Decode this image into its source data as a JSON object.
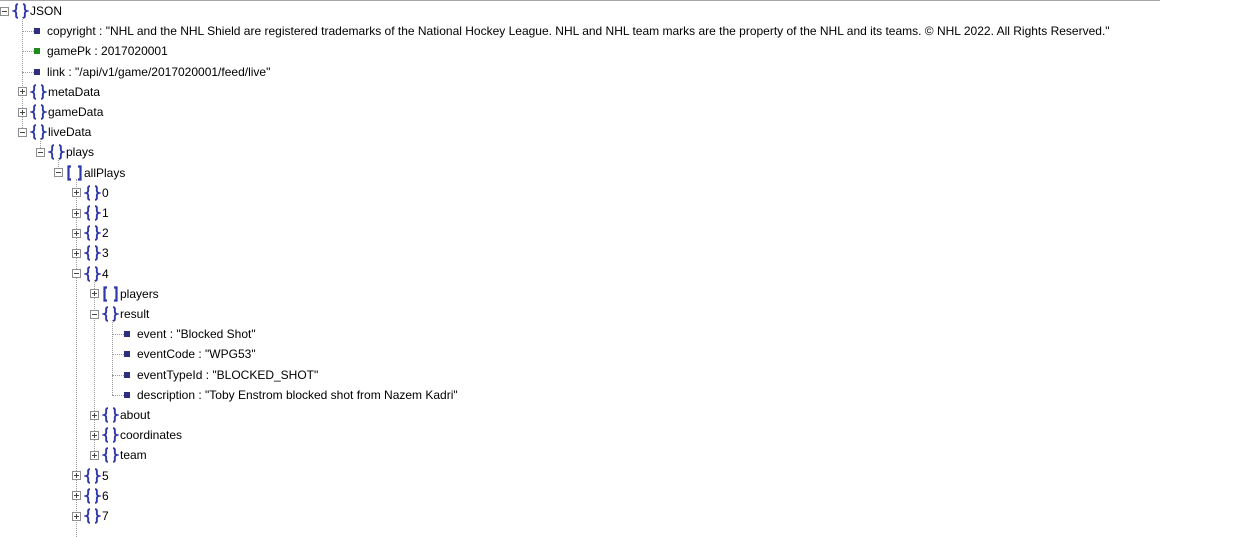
{
  "colors": {
    "object_icon": "#2f37a9",
    "string_bullet": "#2f2f7f",
    "number_bullet": "#1f8c1f",
    "tree_lines": "#9a9a9a"
  },
  "icons": {
    "object": "curly-braces-icon",
    "array": "square-brackets-icon",
    "expand": "plus-box-icon",
    "collapse": "minus-box-icon",
    "value": "square-bullet-icon"
  },
  "rows": [
    {
      "depth": 0,
      "kind": "object",
      "state": "expanded",
      "label": "JSON"
    },
    {
      "depth": 1,
      "kind": "value",
      "vtype": "string",
      "label": "copyright : \"NHL and the NHL Shield are registered trademarks of the National Hockey League. NHL and NHL team marks are the property of the NHL and its teams. © NHL 2022. All Rights Reserved.\""
    },
    {
      "depth": 1,
      "kind": "value",
      "vtype": "number",
      "label": "gamePk : 2017020001"
    },
    {
      "depth": 1,
      "kind": "value",
      "vtype": "string",
      "label": "link : \"/api/v1/game/2017020001/feed/live\""
    },
    {
      "depth": 1,
      "kind": "object",
      "state": "collapsed",
      "label": "metaData"
    },
    {
      "depth": 1,
      "kind": "object",
      "state": "collapsed",
      "label": "gameData"
    },
    {
      "depth": 1,
      "kind": "object",
      "state": "expanded",
      "label": "liveData"
    },
    {
      "depth": 2,
      "kind": "object",
      "state": "expanded",
      "label": "plays"
    },
    {
      "depth": 3,
      "kind": "array",
      "state": "expanded",
      "label": "allPlays"
    },
    {
      "depth": 4,
      "kind": "object",
      "state": "collapsed",
      "label": "0"
    },
    {
      "depth": 4,
      "kind": "object",
      "state": "collapsed",
      "label": "1"
    },
    {
      "depth": 4,
      "kind": "object",
      "state": "collapsed",
      "label": "2"
    },
    {
      "depth": 4,
      "kind": "object",
      "state": "collapsed",
      "label": "3"
    },
    {
      "depth": 4,
      "kind": "object",
      "state": "expanded",
      "label": "4"
    },
    {
      "depth": 5,
      "kind": "array",
      "state": "collapsed",
      "label": "players"
    },
    {
      "depth": 5,
      "kind": "object",
      "state": "expanded",
      "label": "result"
    },
    {
      "depth": 6,
      "kind": "value",
      "vtype": "string",
      "label": "event : \"Blocked Shot\""
    },
    {
      "depth": 6,
      "kind": "value",
      "vtype": "string",
      "label": "eventCode : \"WPG53\""
    },
    {
      "depth": 6,
      "kind": "value",
      "vtype": "string",
      "label": "eventTypeId : \"BLOCKED_SHOT\""
    },
    {
      "depth": 6,
      "kind": "value",
      "vtype": "string",
      "label": "description : \"Toby Enstrom blocked shot from Nazem Kadri\""
    },
    {
      "depth": 5,
      "kind": "object",
      "state": "collapsed",
      "label": "about"
    },
    {
      "depth": 5,
      "kind": "object",
      "state": "collapsed",
      "label": "coordinates"
    },
    {
      "depth": 5,
      "kind": "object",
      "state": "collapsed",
      "label": "team"
    },
    {
      "depth": 4,
      "kind": "object",
      "state": "collapsed",
      "label": "5"
    },
    {
      "depth": 4,
      "kind": "object",
      "state": "collapsed",
      "label": "6"
    },
    {
      "depth": 4,
      "kind": "object",
      "state": "collapsed",
      "label": "7"
    }
  ]
}
